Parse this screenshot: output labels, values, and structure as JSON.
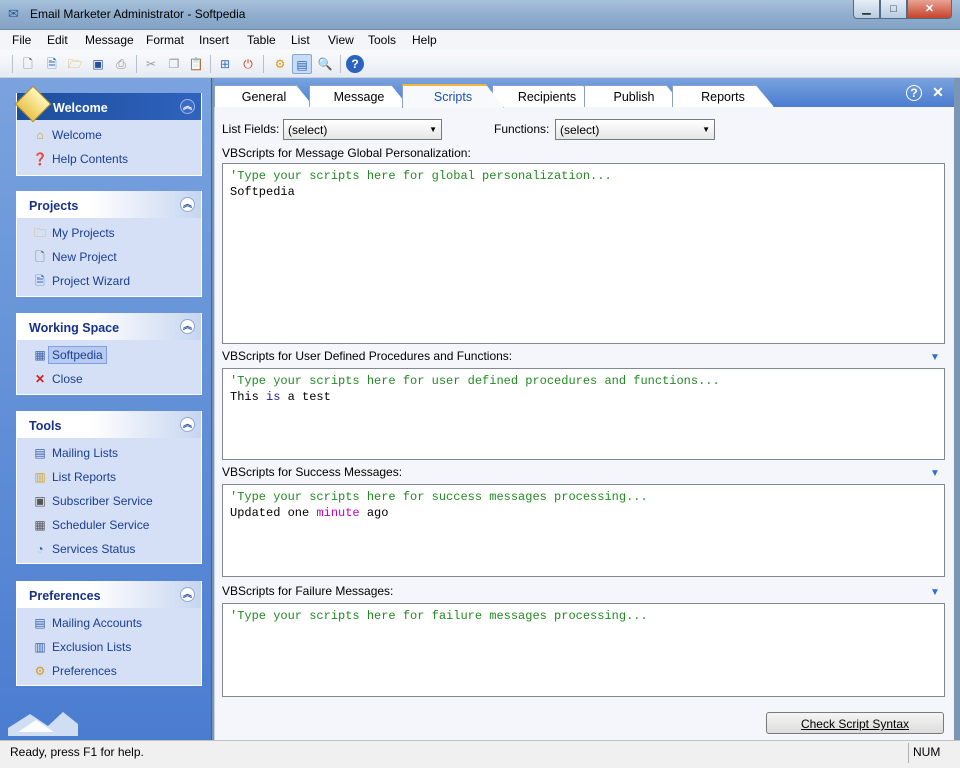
{
  "window": {
    "title": "Email Marketer Administrator - Softpedia",
    "min": "▁",
    "max": "□",
    "close": "✕"
  },
  "menu": [
    "File",
    "Edit",
    "Message",
    "Format",
    "Insert",
    "Table",
    "List",
    "View",
    "Tools",
    "Help"
  ],
  "toolbar": [
    "new-file-icon",
    "new-message-icon",
    "open-folder-icon",
    "save-icon",
    "print-icon",
    "cut-icon",
    "copy-icon",
    "paste-icon",
    "export-icon",
    "stop-icon",
    "settings-gear-icon",
    "view-panel-icon",
    "search-icon",
    "help-icon"
  ],
  "sidebar": {
    "welcome": {
      "title": "Welcome",
      "items": [
        {
          "label": "Welcome",
          "icon": "home-icon"
        },
        {
          "label": "Help Contents",
          "icon": "help-icon"
        }
      ]
    },
    "projects": {
      "title": "Projects",
      "items": [
        {
          "label": "My Projects",
          "icon": "folder-icon"
        },
        {
          "label": "New Project",
          "icon": "document-icon"
        },
        {
          "label": "Project Wizard",
          "icon": "wizard-icon"
        }
      ]
    },
    "workspace": {
      "title": "Working Space",
      "items": [
        {
          "label": "Softpedia",
          "icon": "project-icon"
        },
        {
          "label": "Close",
          "icon": "close-icon"
        }
      ]
    },
    "tools": {
      "title": "Tools",
      "items": [
        {
          "label": "Mailing Lists",
          "icon": "mailing-list-icon"
        },
        {
          "label": "List Reports",
          "icon": "report-icon"
        },
        {
          "label": "Subscriber Service",
          "icon": "service-icon"
        },
        {
          "label": "Scheduler Service",
          "icon": "scheduler-icon"
        },
        {
          "label": "Services Status",
          "icon": "status-icon"
        }
      ]
    },
    "preferences": {
      "title": "Preferences",
      "items": [
        {
          "label": "Mailing Accounts",
          "icon": "accounts-icon"
        },
        {
          "label": "Exclusion Lists",
          "icon": "exclusion-icon"
        },
        {
          "label": "Preferences",
          "icon": "gear-icon"
        }
      ]
    }
  },
  "tabs": [
    "General",
    "Message",
    "Scripts",
    "Recipients",
    "Publish",
    "Reports"
  ],
  "active_tab": "Scripts",
  "scripts": {
    "list_fields_label": "List Fields:",
    "list_fields_value": "(select)",
    "functions_label": "Functions:",
    "functions_value": "(select)",
    "global": {
      "label": "VBScripts for Message Global Personalization:",
      "comment": "'Type your scripts here for global personalization...",
      "line2": "Softpedia"
    },
    "udf": {
      "label": "VBScripts for User Defined Procedures and Functions:",
      "comment": "'Type your scripts here for user defined procedures and functions...",
      "line2_a": "This ",
      "line2_kw": "is",
      "line2_b": " a test"
    },
    "success": {
      "label": "VBScripts for Success Messages:",
      "comment": "'Type your scripts here for success messages processing...",
      "line2_a": "Updated one ",
      "line2_fn": "minute",
      "line2_b": " ago"
    },
    "failure": {
      "label": "VBScripts for Failure Messages:",
      "comment": "'Type your scripts here for failure messages processing..."
    },
    "check_button": "Check Script Syntax"
  },
  "status": {
    "text": "Ready, press F1 for help.",
    "num": "NUM"
  }
}
